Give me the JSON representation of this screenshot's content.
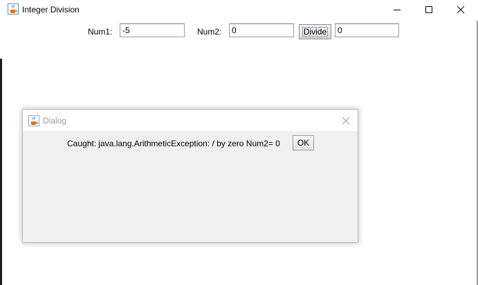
{
  "window": {
    "title": "Integer Division"
  },
  "form": {
    "num1_label": "Num1:",
    "num1_value": "-5",
    "num2_label": "Num2:",
    "num2_value": "0",
    "divide_label": "Divide",
    "result_value": "0"
  },
  "dialog": {
    "title": "Dialog",
    "message": "Caught: java.lang.ArithmeticException: / by zero Num2= 0",
    "ok_label": "OK"
  },
  "icons": {
    "window_icon": "java-coffee-cup-icon",
    "minimize": "minimize-icon",
    "maximize": "maximize-icon",
    "close": "close-icon"
  }
}
